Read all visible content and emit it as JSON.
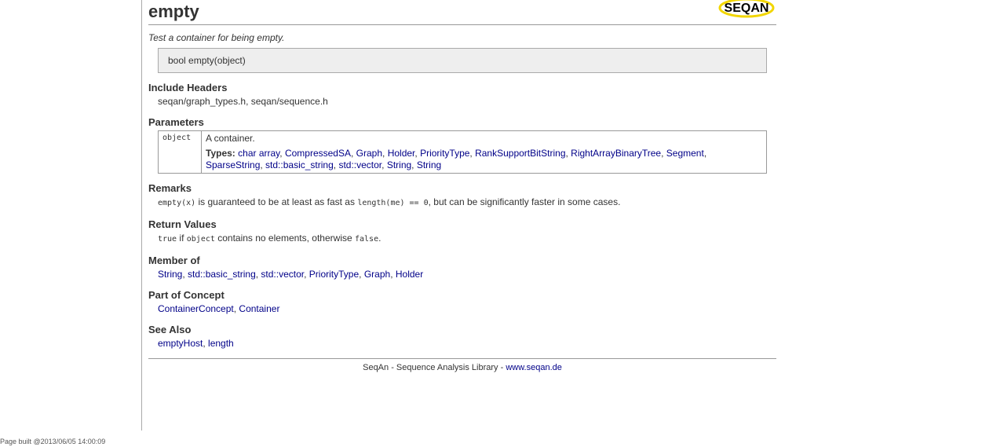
{
  "title": "empty",
  "logo_text": "SEQAN",
  "summary": "Test a container for being empty.",
  "signature": "bool empty(object)",
  "include_headers": {
    "title": "Include Headers",
    "value": "seqan/graph_types.h, seqan/sequence.h"
  },
  "parameters": {
    "title": "Parameters",
    "name": "object",
    "description": "A container.",
    "types_label": "Types:",
    "types": [
      "char array",
      "CompressedSA",
      "Graph",
      "Holder",
      "PriorityType",
      "RankSupportBitString",
      "RightArrayBinaryTree",
      "Segment",
      "SparseString",
      "std::basic_string",
      "std::vector",
      "String",
      "String"
    ]
  },
  "remarks": {
    "title": "Remarks",
    "code1": "empty(x)",
    "text1": " is guaranteed to be at least as fast as ",
    "code2": "length(me) == 0",
    "text2": ", but can be significantly faster in some cases."
  },
  "return_values": {
    "title": "Return Values",
    "code1": "true",
    "text1": " if ",
    "code2": "object",
    "text2": " contains no elements, otherwise ",
    "code3": "false",
    "text3": "."
  },
  "member_of": {
    "title": "Member of",
    "links": [
      "String",
      "std::basic_string",
      "std::vector",
      "PriorityType",
      "Graph",
      "Holder"
    ]
  },
  "part_of_concept": {
    "title": "Part of Concept",
    "links": [
      "ContainerConcept",
      "Container"
    ]
  },
  "see_also": {
    "title": "See Also",
    "links": [
      "emptyHost",
      "length"
    ]
  },
  "footer": {
    "text": "SeqAn - Sequence Analysis Library - ",
    "link": "www.seqan.de"
  },
  "build_info": "Page built @2013/06/05 14:00:09",
  "colors": {
    "link": "#000088",
    "logo_yellow": "#f2d600",
    "signature_bg": "#eeeeee"
  }
}
